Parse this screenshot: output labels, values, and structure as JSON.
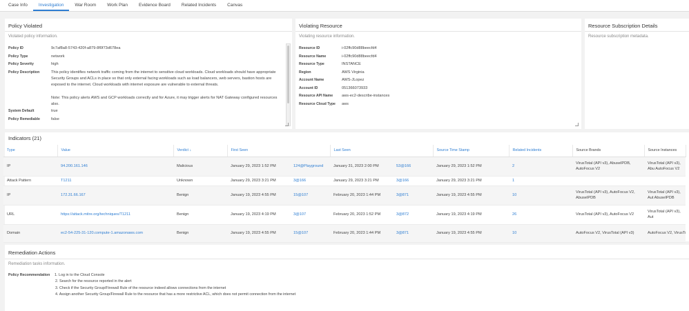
{
  "tabs": [
    "Case Info",
    "Investigation",
    "War Room",
    "Work Plan",
    "Evidence Board",
    "Related Incidents",
    "Canvas"
  ],
  "policy": {
    "title": "Policy Violated",
    "subtitle": "Violated policy information.",
    "fields": [
      {
        "key": "Policy ID",
        "value": "9c7af8a8-5743-420f-a879-8f0f73d678ea"
      },
      {
        "key": "Policy Type",
        "value": "network"
      },
      {
        "key": "Policy Severity",
        "value": "high"
      },
      {
        "key": "Policy Description",
        "value": "This policy identifies network traffic coming from the internet to sensitive cloud workloads. Cloud workloads should have appropriate Security Groups and ACLs in place so that only external facing workloads such as load balancers, web servers, bastion hosts are exposed to the internet. Cloud workloads with internet exposure are vulnerable to external threats.\n\nNote: This policy alerts AWS and GCP workloads correctly and for Azure, it may trigger alerts for NAT Gateway configured resources also."
      },
      {
        "key": "System Default",
        "value": "true"
      },
      {
        "key": "Policy Remediable",
        "value": "false"
      }
    ]
  },
  "resource": {
    "title": "Violating Resource",
    "subtitle": "Violating resource information.",
    "fields": [
      {
        "key": "Resource ID",
        "value": "i-02ffc90d88beecfd4"
      },
      {
        "key": "Resource Name",
        "value": "i-02ffc90d88beecfd4"
      },
      {
        "key": "Resource Type",
        "value": "INSTANCE"
      },
      {
        "key": "Region",
        "value": "AWS Virginia"
      },
      {
        "key": "Account Name",
        "value": "AWS-JLopez"
      },
      {
        "key": "Account ID",
        "value": "051366073933"
      },
      {
        "key": "Resource API Name",
        "value": "aws-ec2-describe-instances"
      },
      {
        "key": "Resource Cloud Type",
        "value": "aws"
      }
    ]
  },
  "subscription": {
    "title": "Resource Subscription Details",
    "subtitle": "Resource subscription metadata."
  },
  "indicators": {
    "title": "Indicators (21)",
    "columns": [
      "Type",
      "Value",
      "Verdict ↓",
      "First Seen",
      "Last Seen",
      "Source Time Stamp",
      "Related Incidents",
      "Source Brands",
      "Source Instances"
    ],
    "rows": [
      {
        "type": "IP",
        "value": "94.200.161.146",
        "verdict": "Malicious",
        "first_seen": "January 29, 2023 1:52 PM",
        "first_seen_by": "124@Playground",
        "last_seen": "January 31, 2023 2:00 PM",
        "last_seen_by": "53@166",
        "source_ts": "January 29, 2023 1:52 PM",
        "related": "2",
        "brands": "VirusTotal (API v3), AbuseIPDB, AutoFocus V2",
        "instances": "VirusTotal (API v3), Abu AutoFocus V2"
      },
      {
        "type": "Attack Pattern",
        "value": "T1211",
        "verdict": "Unknown",
        "first_seen": "January 29, 2023 3:21 PM",
        "first_seen_by": "3@166",
        "last_seen": "January 29, 2023 3:21 PM",
        "last_seen_by": "3@166",
        "source_ts": "January 29, 2023 3:21 PM",
        "related": "1",
        "brands": "",
        "instances": ""
      },
      {
        "type": "IP",
        "value": "172.31.66.167",
        "verdict": "Benign",
        "first_seen": "January 19, 2023 4:55 PM",
        "first_seen_by": "15@107",
        "last_seen": "February 20, 2023 1:44 PM",
        "last_seen_by": "3@871",
        "source_ts": "January 19, 2023 4:55 PM",
        "related": "10",
        "brands": "VirusTotal (API v3), AutoFocus V2, AbuseIPDB",
        "instances": "VirusTotal (API v3), Aut AbuseIPDB"
      },
      {
        "type": "URL",
        "value": "https://attack.mitre.org/techniques/T1211",
        "verdict": "Benign",
        "first_seen": "January 19, 2023 4:19 PM",
        "first_seen_by": "3@107",
        "last_seen": "February 20, 2023 1:52 PM",
        "last_seen_by": "3@872",
        "source_ts": "January 19, 2023 4:19 PM",
        "related": "26",
        "brands": "VirusTotal (API v3), AutoFocus V2",
        "instances": "VirusTotal (API v3), Aut"
      },
      {
        "type": "Domain",
        "value": "ec2-54-225-31-120.compute-1.amazonaws.com",
        "verdict": "Benign",
        "first_seen": "January 19, 2023 4:55 PM",
        "first_seen_by": "15@107",
        "last_seen": "February 20, 2023 1:44 PM",
        "last_seen_by": "3@871",
        "source_ts": "January 19, 2023 4:55 PM",
        "related": "10",
        "brands": "AutoFocus V2, VirusTotal (API v3)",
        "instances": "AutoFocus V2, VirusTot"
      }
    ]
  },
  "remediation": {
    "title": "Remediation Actions",
    "subtitle": "Remediation tasks information.",
    "label": "Policy Recommendation",
    "steps": [
      "1. Log in to the Cloud Console",
      "2. Search for the resource reported in the alert",
      "3. Check if the Security Group/Firewall Rule of the resource indeed allows connections from the internet",
      "4. Assign another Security Group/Firewall Rule to the resource that has a more restrictive ACL, which does not permit connection from the internet"
    ]
  }
}
